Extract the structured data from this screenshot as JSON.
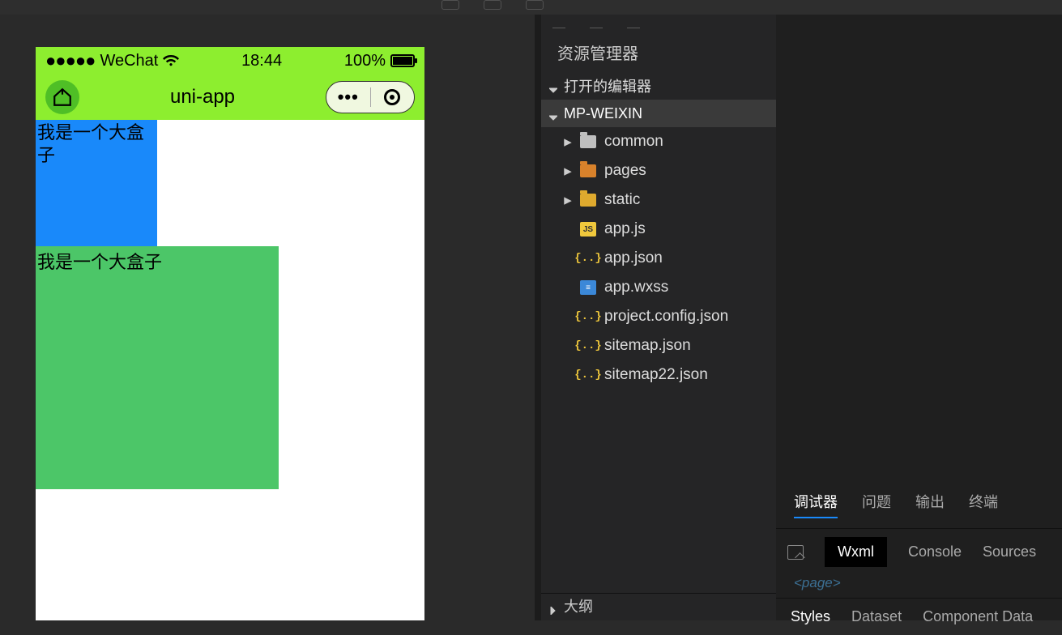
{
  "statusbar": {
    "carrier": "WeChat",
    "time": "18:44",
    "battery": "100%"
  },
  "navbar": {
    "title": "uni-app"
  },
  "page": {
    "box1_text": "我是一个大盒子",
    "box2_text": "我是一个大盒子"
  },
  "explorer": {
    "title": "资源管理器",
    "open_editors": "打开的编辑器",
    "project": "MP-WEIXIN",
    "folders": [
      {
        "name": "common",
        "color": "gray"
      },
      {
        "name": "pages",
        "color": "orange"
      },
      {
        "name": "static",
        "color": "yellow"
      }
    ],
    "files": [
      {
        "name": "app.js",
        "kind": "js"
      },
      {
        "name": "app.json",
        "kind": "json"
      },
      {
        "name": "app.wxss",
        "kind": "wxss"
      },
      {
        "name": "project.config.json",
        "kind": "json"
      },
      {
        "name": "sitemap.json",
        "kind": "json"
      },
      {
        "name": "sitemap22.json",
        "kind": "json"
      }
    ],
    "outline": "大纲"
  },
  "devtools": {
    "tabs1": {
      "debugger": "调试器",
      "problems": "问题",
      "output": "输出",
      "terminal": "终端"
    },
    "tabs2": {
      "wxml": "Wxml",
      "console": "Console",
      "sources": "Sources"
    },
    "page_tag": "<page>",
    "tabs3": {
      "styles": "Styles",
      "dataset": "Dataset",
      "component": "Component Data"
    }
  }
}
